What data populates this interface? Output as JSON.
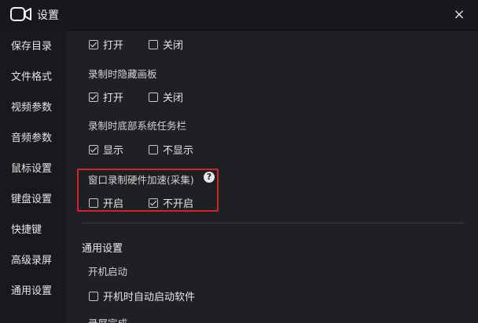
{
  "window": {
    "title": "设置",
    "close_icon": "×"
  },
  "sidebar": {
    "items": [
      {
        "label": "保存目录"
      },
      {
        "label": "文件格式"
      },
      {
        "label": "视频参数"
      },
      {
        "label": "音频参数"
      },
      {
        "label": "鼠标设置"
      },
      {
        "label": "键盘设置"
      },
      {
        "label": "快捷键"
      },
      {
        "label": "高级录屏"
      },
      {
        "label": "通用设置"
      }
    ]
  },
  "main": {
    "top_group": {
      "on": {
        "label": "打开",
        "checked": true
      },
      "off": {
        "label": "关闭",
        "checked": false
      }
    },
    "hide_panel": {
      "label": "录制时隐藏画板",
      "on": {
        "label": "打开",
        "checked": true
      },
      "off": {
        "label": "关闭",
        "checked": false
      }
    },
    "taskbar": {
      "label": "录制时底部系统任务栏",
      "show": {
        "label": "显示",
        "checked": true
      },
      "hide": {
        "label": "不显示",
        "checked": false
      }
    },
    "hw_accel": {
      "label": "窗口录制硬件加速(采集)",
      "help_icon": "?",
      "enable": {
        "label": "开启",
        "checked": false
      },
      "disable": {
        "label": "不开启",
        "checked": true
      }
    },
    "general": {
      "title": "通用设置",
      "startup_label": "开机启动",
      "autostart": {
        "label": "开机时自动启动软件",
        "checked": false
      },
      "record_done_label": "录屏完成"
    }
  },
  "colors": {
    "highlight": "#d0232a",
    "background": "#1f2023",
    "sidebar": "#18191c"
  }
}
